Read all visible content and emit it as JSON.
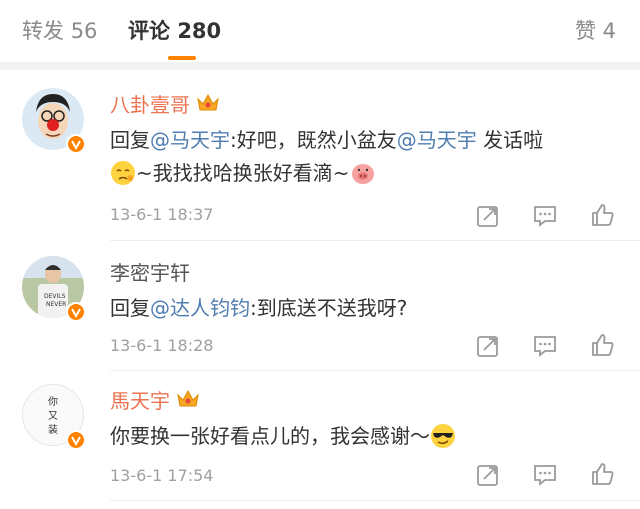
{
  "tabs": {
    "repost_label": "转发",
    "repost_count": "56",
    "comment_label": "评论",
    "comment_count": "280",
    "like_label": "赞",
    "like_count": "4"
  },
  "colors": {
    "accent": "#ff8200",
    "name_vip": "#eb7350",
    "mention": "#507daf",
    "muted": "#a0a0a0"
  },
  "icons": [
    "crown-icon",
    "verified-icon",
    "share-icon",
    "comment-icon",
    "like-icon",
    "emoji-pensive",
    "emoji-pig",
    "emoji-sunglasses"
  ],
  "comments": [
    {
      "name": "八卦壹哥",
      "reply_prefix": "回复",
      "mention1": "@马天宇",
      "text1": ":好吧，既然小盆友",
      "mention2": "@马天宇",
      "text2": " 发话啦",
      "text3": "~我找找哈换张好看滴~",
      "time": "13-6-1 18:37"
    },
    {
      "name": "李密宇轩",
      "reply_prefix": "回复",
      "mention1": "@达人钧钧",
      "text1": ":到底送不送我呀?",
      "time": "13-6-1 18:28"
    },
    {
      "name": "馬天宇",
      "text1": "你要换一张好看点儿的，我会感谢～",
      "time": "13-6-1 17:54",
      "avatar_text": "你又装"
    }
  ]
}
